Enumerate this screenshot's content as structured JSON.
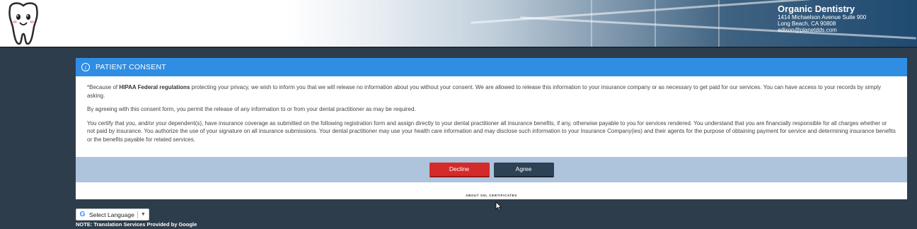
{
  "header": {
    "clinic_name": "Organic Dentistry",
    "address_line1": "1414 Michaelson Avenue Suite 900",
    "address_line2": "Long Beach, CA 90808",
    "email": "adixon@planetdds.com",
    "logo_icon": "tooth-mascot-icon"
  },
  "consent": {
    "title": "PATIENT CONSENT",
    "title_icon": "info-icon",
    "p1_prefix": "*Because of ",
    "p1_bold": "HIPAA Federal regulations",
    "p1_rest": " protecting your privacy, we wish to inform you that we will release no information about you without your consent. We are allowed to release this information to your insurance company or as necessary to get paid for our services. You can have access to your records by simply asking.",
    "p2": "By agreeing with this consent form, you permit the release of any information to or from your dental practitioner as may be required.",
    "p3": "You certify that you, and/or your dependent(s), have insurance coverage as submitted on the following registration form and assign directly to your dental practitioner all insurance benefits, if any, otherwise payable to you for services rendered. You understand that you are financially responsible for all charges whether or not paid by insurance. You authorize the use of your signature on all insurance submissions. Your dental practitioner may use your health care information and may disclose such information to your Insurance Company(ies) and their agents for the purpose of obtaining payment for service and determining insurance benefits or the benefits payable for related services.",
    "decline_label": "Decline",
    "agree_label": "Agree",
    "decline_color": "#d42a2a",
    "agree_color": "#2e4256",
    "ssl_link": "ABOUT SSL CERTIFICATES"
  },
  "translate": {
    "select_label": "Select Language",
    "caret": "▼",
    "google_icon": "google-g-icon",
    "note": "NOTE: Translation Services Provided by Google"
  },
  "colors": {
    "page_bg": "#2e3d4b",
    "panel_head": "#2f8de4",
    "action_bar": "#aec4dc"
  }
}
